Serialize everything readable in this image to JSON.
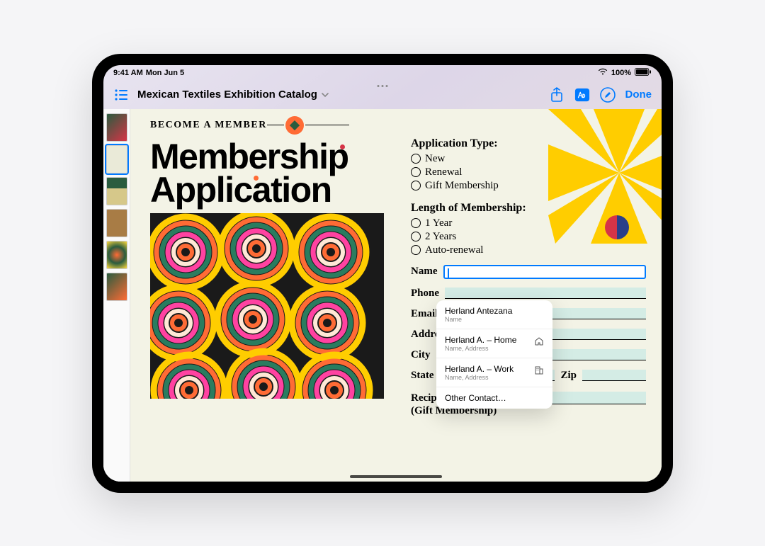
{
  "status": {
    "time": "9:41 AM",
    "date": "Mon Jun 5",
    "battery_pct": "100%"
  },
  "header": {
    "doc_title": "Mexican Textiles Exhibition Catalog",
    "done_label": "Done"
  },
  "document": {
    "pretitle": "BECOME A MEMBER",
    "title_line1": "Membership",
    "title_line2": "Application",
    "app_type_heading": "Application Type:",
    "app_type_options": [
      "New",
      "Renewal",
      "Gift Membership"
    ],
    "length_heading": "Length of Membership:",
    "length_options": [
      "1 Year",
      "2 Years",
      "Auto-renewal"
    ],
    "fields": {
      "name": "Name",
      "phone": "Phone",
      "email": "Email",
      "address": "Address",
      "city": "City",
      "state": "State",
      "zip": "Zip",
      "recipient_l1": "Recipient's Name",
      "recipient_l2": "(Gift Membership)"
    }
  },
  "autofill": {
    "item1_title": "Herland Antezana",
    "item1_sub": "Name",
    "item2_title": "Herland A. – Home",
    "item2_sub": "Name, Address",
    "item3_title": "Herland A. – Work",
    "item3_sub": "Name, Address",
    "other": "Other Contact…"
  }
}
